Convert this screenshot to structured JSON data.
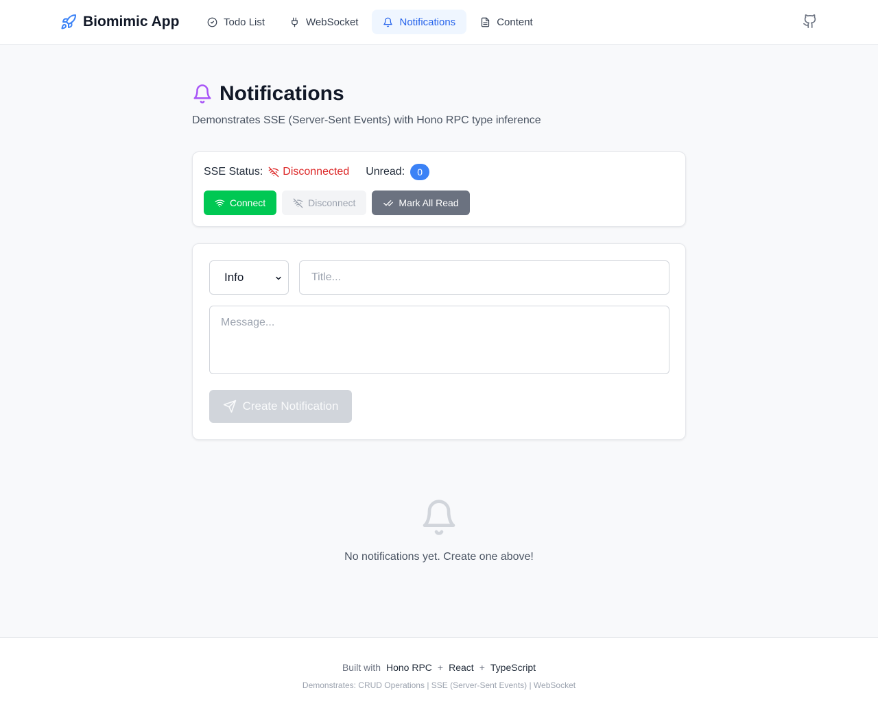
{
  "header": {
    "brand": "Biomimic App",
    "nav": [
      {
        "label": "Todo List",
        "icon": "check-circle-icon",
        "active": false
      },
      {
        "label": "WebSocket",
        "icon": "plug-icon",
        "active": false
      },
      {
        "label": "Notifications",
        "icon": "bell-icon",
        "active": true
      },
      {
        "label": "Content",
        "icon": "document-icon",
        "active": false
      }
    ],
    "github_icon": "github-icon"
  },
  "page": {
    "title": "Notifications",
    "subtitle": "Demonstrates SSE (Server-Sent Events) with Hono RPC type inference"
  },
  "status": {
    "sse_label": "SSE Status:",
    "sse_value": "Disconnected",
    "unread_label": "Unread:",
    "unread_count": "0",
    "buttons": {
      "connect": "Connect",
      "disconnect": "Disconnect",
      "mark_all_read": "Mark All Read"
    }
  },
  "form": {
    "type_selected": "Info",
    "title_placeholder": "Title...",
    "message_placeholder": "Message...",
    "submit": "Create Notification"
  },
  "empty": {
    "text": "No notifications yet. Create one above!"
  },
  "footer": {
    "built_with": "Built with",
    "techs": [
      "Hono RPC",
      "React",
      "TypeScript"
    ],
    "plus": "+",
    "demonstrates": "Demonstrates: CRUD Operations | SSE (Server-Sent Events) | WebSocket"
  },
  "colors": {
    "accent": "#2563eb",
    "connect": "#00c853",
    "danger": "#dc2626",
    "bell_purple": "#a855f7",
    "badge": "#3b82f6"
  }
}
